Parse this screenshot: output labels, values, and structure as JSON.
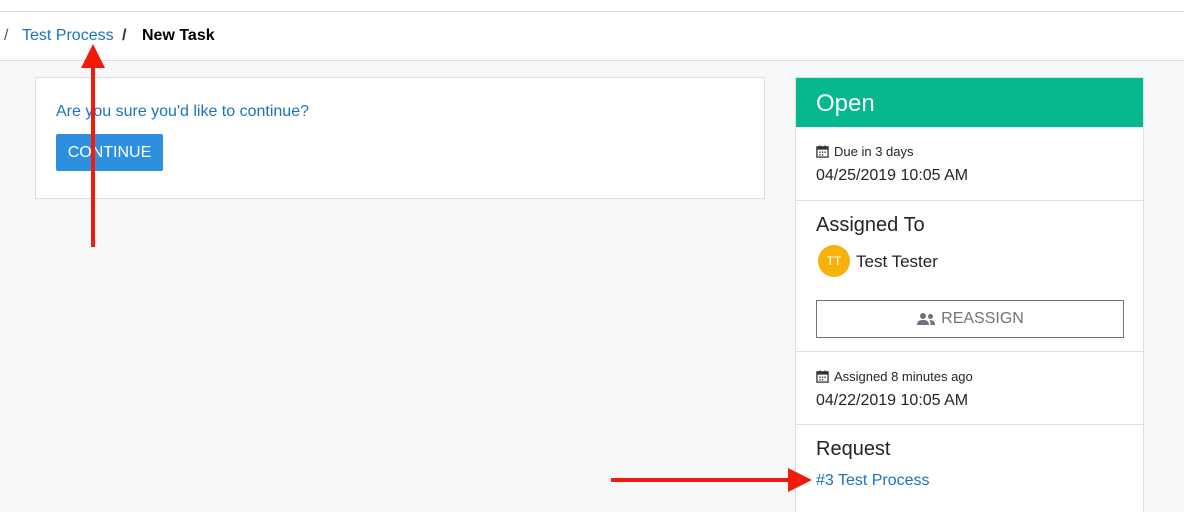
{
  "breadcrumb": {
    "separator": "/",
    "parent_label": "Test Process",
    "current_label": "New Task"
  },
  "confirm": {
    "message": "Are you sure you'd like to continue?",
    "continue_label": "CONTINUE"
  },
  "sidebar": {
    "status": "Open",
    "status_color": "#06b88d",
    "due": {
      "icon": "calendar-icon",
      "label": "Due in 3 days",
      "date": "04/25/2019 10:05 AM"
    },
    "assigned_to": {
      "title": "Assigned To",
      "avatar_initials": "TT",
      "avatar_color": "#f6b10b",
      "name": "Test Tester",
      "reassign_icon": "users-icon",
      "reassign_label": "REASSIGN"
    },
    "assigned_date": {
      "icon": "calendar-icon",
      "label": "Assigned 8 minutes ago",
      "date": "04/22/2019 10:05 AM"
    },
    "request": {
      "title": "Request",
      "link_label": "#3 Test Process"
    }
  },
  "annotation_color": "#f21a0a"
}
